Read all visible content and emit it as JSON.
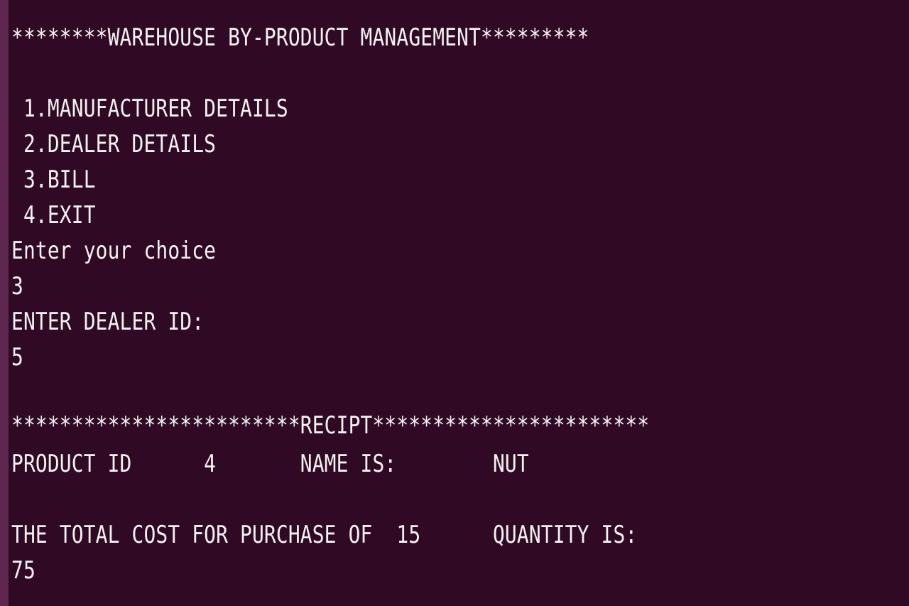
{
  "terminal": {
    "lines": [
      "********WAREHOUSE BY-PRODUCT MANAGEMENT*********",
      " 1.MANUFACTURER DETAILS",
      " 2.DEALER DETAILS",
      " 3.BILL",
      " 4.EXIT",
      "Enter your choice",
      "3",
      "ENTER DEALER ID:",
      "5",
      "************************RECIPT***********************",
      "PRODUCT ID      4       NAME IS:        NUT",
      "THE TOTAL COST FOR PURCHASE OF  15      QUANTITY IS:",
      "75"
    ]
  },
  "colors": {
    "background": "#300a24",
    "foreground": "#f2f2f2",
    "edge": "#5e2750"
  }
}
